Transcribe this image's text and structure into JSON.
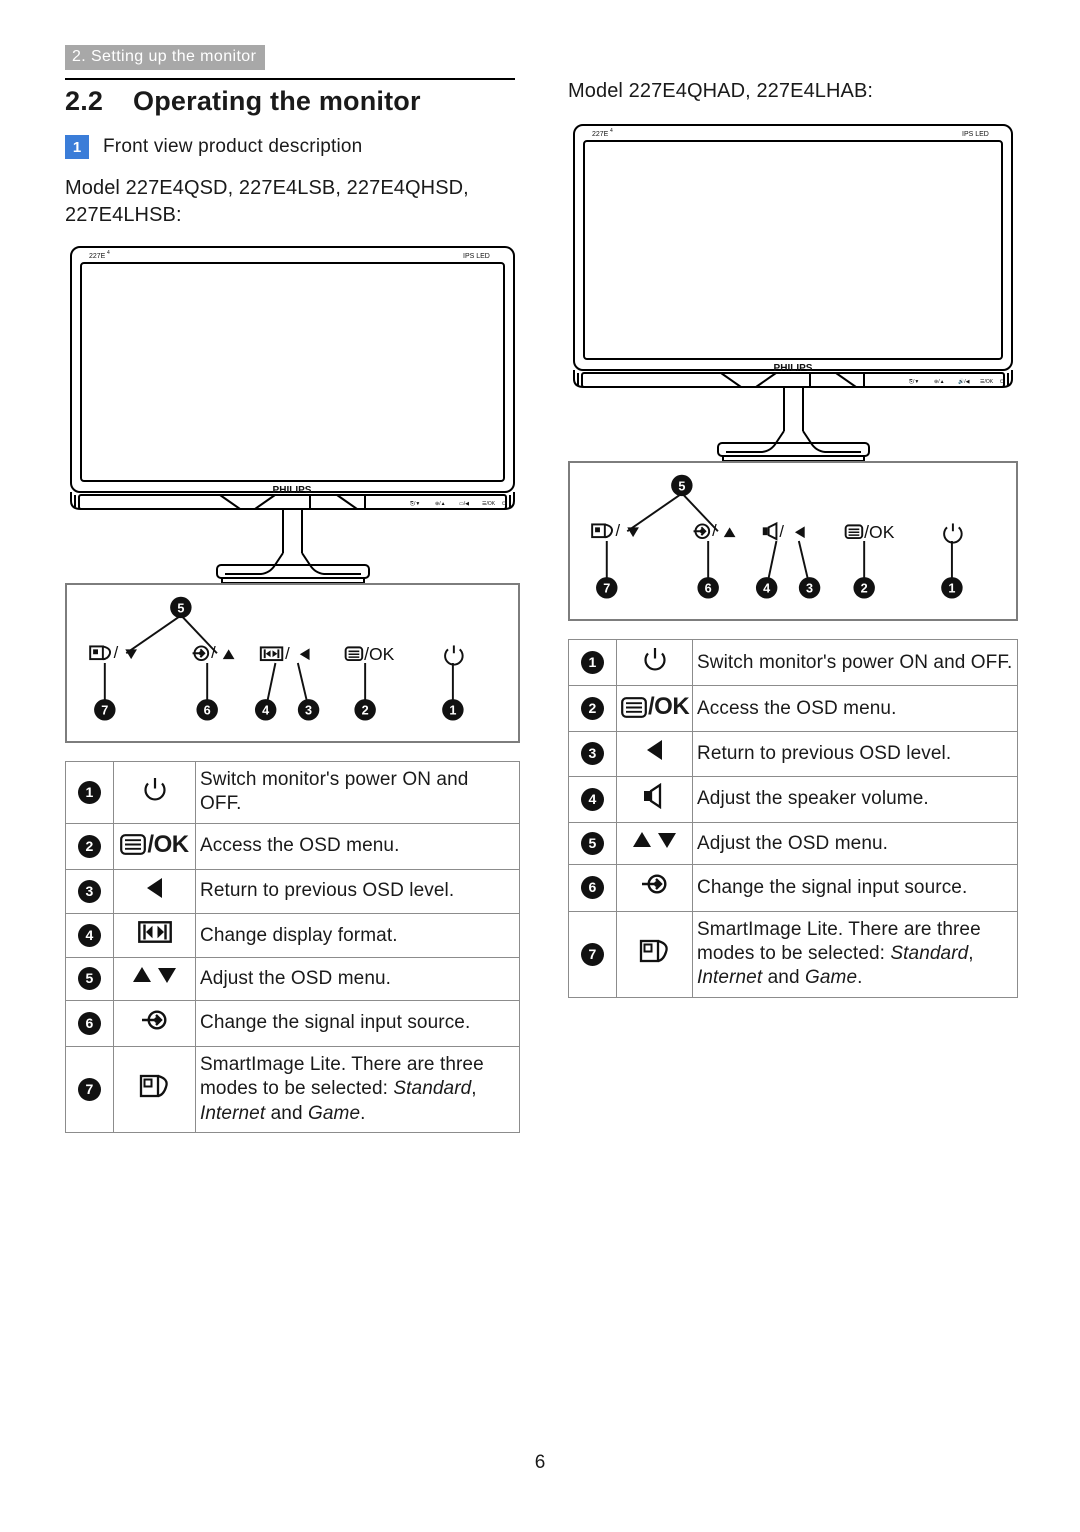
{
  "header": {
    "running_head": "2. Setting up the monitor"
  },
  "section": {
    "number": "2.2",
    "title": "Operating the monitor",
    "badge": "1",
    "subhead": "Front view product description"
  },
  "colors": {
    "running_head_bg": "#a8a8a8",
    "badge_blue": "#3b7dd8",
    "table_border": "#8c8c8c",
    "callout_border": "#7d7d7d"
  },
  "left": {
    "model_line": "Model 227E4QSD, 227E4LSB, 227E4QHSD, 227E4LHSB:",
    "monitor": {
      "bezel_model_label": "227E",
      "bezel_model_sup": "4",
      "bezel_panel_label": "IPS LED",
      "brand": "PHILIPS"
    },
    "callout": {
      "top_marker": "5",
      "buttons": [
        {
          "marker": "7",
          "icon": "smartimage-icon",
          "glyph_label": "/▼"
        },
        {
          "marker": "6",
          "icon": "input-source-icon",
          "glyph_label": "/▲"
        },
        {
          "marker": "4",
          "icon": "display-format-icon",
          "glyph_label": "/◀",
          "paired_marker": "3"
        },
        {
          "marker": "2",
          "icon": "osd-menu-icon",
          "glyph_label": "/OK"
        },
        {
          "marker": "1",
          "icon": "power-icon",
          "glyph_label": ""
        }
      ]
    },
    "table": {
      "rows": [
        {
          "num": "1",
          "icon": "power-icon",
          "desc": "Switch monitor's power ON and OFF."
        },
        {
          "num": "2",
          "icon": "osd-menu-ok-icon",
          "desc": "Access the OSD menu.",
          "icon_text": "/OK"
        },
        {
          "num": "3",
          "icon": "left-arrow-icon",
          "desc": "Return to previous OSD level."
        },
        {
          "num": "4",
          "icon": "display-format-icon",
          "desc": "Change display format."
        },
        {
          "num": "5",
          "icon": "up-down-arrows-icon",
          "desc": "Adjust the OSD menu."
        },
        {
          "num": "6",
          "icon": "input-source-icon",
          "desc": "Change the signal input source."
        },
        {
          "num": "7",
          "icon": "smartimage-icon",
          "desc_parts": [
            "SmartImage Lite. There are three modes to be selected: ",
            "Standard",
            ", ",
            "Internet",
            " and ",
            "Game",
            "."
          ]
        }
      ]
    }
  },
  "right": {
    "model_line": "Model 227E4QHAD, 227E4LHAB:",
    "monitor": {
      "bezel_model_label": "227E",
      "bezel_model_sup": "4",
      "bezel_panel_label": "IPS LED",
      "brand": "PHILIPS"
    },
    "callout": {
      "top_marker": "5",
      "buttons": [
        {
          "marker": "7",
          "icon": "smartimage-icon",
          "glyph_label": "/▼"
        },
        {
          "marker": "6",
          "icon": "input-source-icon",
          "glyph_label": "/▲"
        },
        {
          "marker": "4",
          "icon": "speaker-icon",
          "glyph_label": "/◀",
          "paired_marker": "3"
        },
        {
          "marker": "2",
          "icon": "osd-menu-icon",
          "glyph_label": "/OK"
        },
        {
          "marker": "1",
          "icon": "power-icon",
          "glyph_label": ""
        }
      ]
    },
    "table": {
      "rows": [
        {
          "num": "1",
          "icon": "power-icon",
          "desc": "Switch monitor's power ON and OFF."
        },
        {
          "num": "2",
          "icon": "osd-menu-ok-icon",
          "desc": "Access the OSD menu.",
          "icon_text": "/OK"
        },
        {
          "num": "3",
          "icon": "left-arrow-icon",
          "desc": "Return to previous OSD level."
        },
        {
          "num": "4",
          "icon": "speaker-icon",
          "desc": "Adjust the speaker volume."
        },
        {
          "num": "5",
          "icon": "up-down-arrows-icon",
          "desc": "Adjust the OSD menu."
        },
        {
          "num": "6",
          "icon": "input-source-icon",
          "desc": "Change the signal input source."
        },
        {
          "num": "7",
          "icon": "smartimage-icon",
          "desc_parts": [
            "SmartImage Lite. There are three modes to be selected: ",
            "Standard",
            ", ",
            "Internet",
            " and ",
            "Game",
            "."
          ]
        }
      ]
    }
  },
  "footer": {
    "page_number": "6"
  }
}
